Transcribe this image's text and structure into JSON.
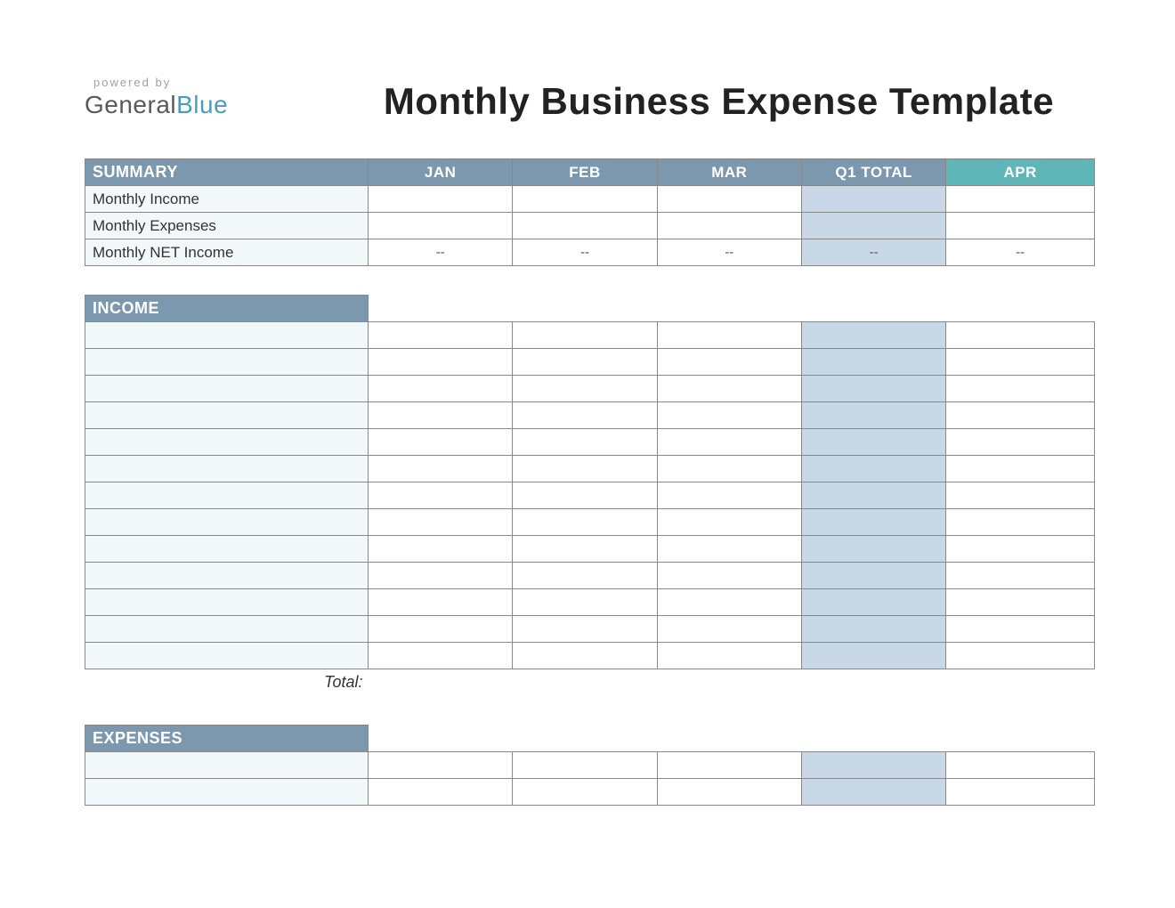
{
  "logo": {
    "powered_by": "powered by",
    "brand_general": "General",
    "brand_blue": "Blue"
  },
  "title": "Monthly Business Expense Template",
  "columns": {
    "summary": "SUMMARY",
    "jan": "JAN",
    "feb": "FEB",
    "mar": "MAR",
    "q1total": "Q1 TOTAL",
    "apr": "APR"
  },
  "summary_rows": [
    {
      "label": "Monthly Income",
      "jan": "",
      "feb": "",
      "mar": "",
      "q1": "",
      "apr": ""
    },
    {
      "label": "Monthly Expenses",
      "jan": "",
      "feb": "",
      "mar": "",
      "q1": "",
      "apr": ""
    },
    {
      "label": "Monthly NET Income",
      "jan": "--",
      "feb": "--",
      "mar": "--",
      "q1": "--",
      "apr": "--"
    }
  ],
  "income": {
    "header": "INCOME",
    "row_count": 13,
    "total_label": "Total:"
  },
  "expenses": {
    "header": "EXPENSES",
    "row_count": 2
  }
}
